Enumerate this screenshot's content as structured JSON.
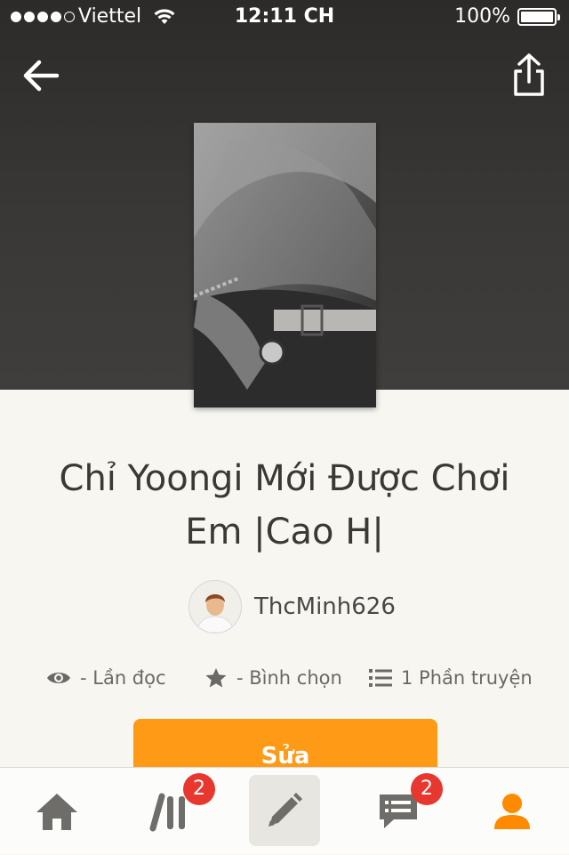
{
  "status_bar": {
    "carrier": "Viettel",
    "time": "12:11 CH",
    "battery": "100%"
  },
  "story": {
    "title_line1": "Chỉ Yoongi Mới Được Chơi",
    "title_line2": "Em |Cao H|",
    "author": "ThcMinh626"
  },
  "stats": {
    "reads": "- Lần đọc",
    "votes": "- Bình chọn",
    "parts": "1 Phần truyện"
  },
  "actions": {
    "edit_label": "Sửa"
  },
  "tabbar": {
    "library_badge": "2",
    "messages_badge": "2"
  },
  "colors": {
    "accent": "#ff9a17",
    "badge": "#e8372f"
  },
  "icons": [
    "back-arrow-icon",
    "share-icon",
    "eye-icon",
    "star-icon",
    "list-icon",
    "home-icon",
    "library-icon",
    "pencil-icon",
    "chat-icon",
    "profile-icon"
  ]
}
